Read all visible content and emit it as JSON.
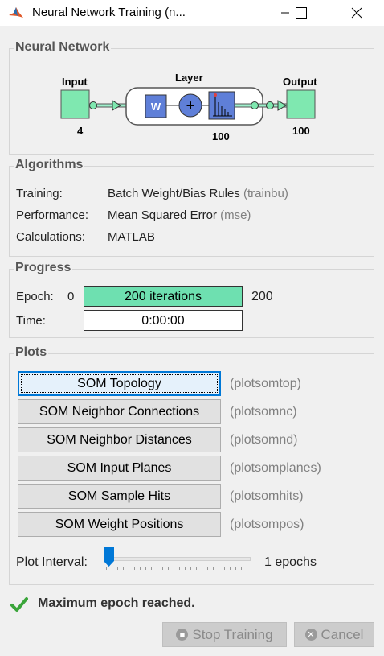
{
  "window": {
    "title": "Neural Network Training (n..."
  },
  "network": {
    "section_title": "Neural Network",
    "input_label": "Input",
    "input_size": "4",
    "layer_label": "Layer",
    "layer_size": "100",
    "output_label": "Output",
    "output_size": "100",
    "weight_symbol": "W",
    "sum_symbol": "+"
  },
  "algorithms": {
    "section_title": "Algorithms",
    "rows": [
      {
        "label": "Training:",
        "value": "Batch Weight/Bias Rules",
        "fn": "(trainbu)"
      },
      {
        "label": "Performance:",
        "value": "Mean Squared Error",
        "fn": "(mse)"
      },
      {
        "label": "Calculations:",
        "value": "MATLAB",
        "fn": ""
      }
    ]
  },
  "progress": {
    "section_title": "Progress",
    "epoch_label": "Epoch:",
    "epoch_start": "0",
    "epoch_bar_text": "200 iterations",
    "epoch_end": "200",
    "epoch_fraction": 1.0,
    "time_label": "Time:",
    "time_value": "0:00:00"
  },
  "plots": {
    "section_title": "Plots",
    "buttons": [
      {
        "label": "SOM Topology",
        "fn": "(plotsomtop)"
      },
      {
        "label": "SOM Neighbor Connections",
        "fn": "(plotsomnc)"
      },
      {
        "label": "SOM Neighbor Distances",
        "fn": "(plotsomnd)"
      },
      {
        "label": "SOM Input Planes",
        "fn": "(plotsomplanes)"
      },
      {
        "label": "SOM Sample Hits",
        "fn": "(plotsomhits)"
      },
      {
        "label": "SOM Weight Positions",
        "fn": "(plotsompos)"
      }
    ],
    "interval_label": "Plot Interval:",
    "interval_value": "1 epochs"
  },
  "status": {
    "message": "Maximum epoch reached."
  },
  "actions": {
    "stop_label": "Stop Training",
    "cancel_label": "Cancel"
  },
  "colors": {
    "accent": "#0078d7",
    "progress_fill": "#6ee0b0",
    "node_fill": "#7fe8b0",
    "status_check": "#3aa53a"
  }
}
